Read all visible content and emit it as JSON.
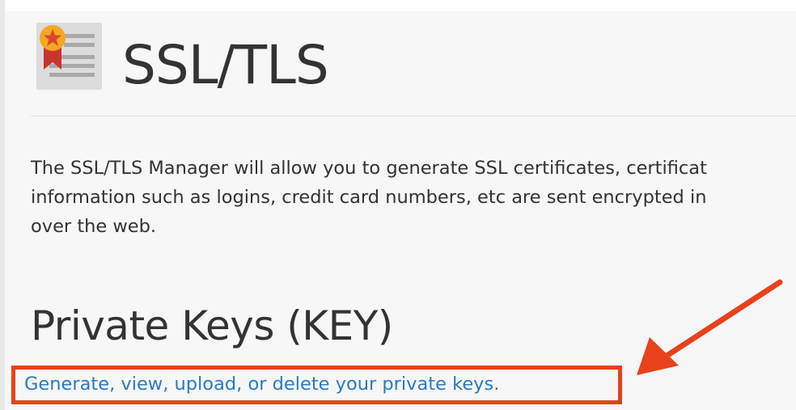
{
  "header": {
    "title": "SSL/TLS",
    "icon": "certificate-icon"
  },
  "description": {
    "text": "The SSL/TLS Manager will allow you to generate SSL certificates, certificat\ninformation such as logins, credit card numbers, etc are sent encrypted in\nover the web."
  },
  "private_keys": {
    "heading": "Private Keys (KEY)",
    "link_label": "Generate, view, upload, or delete your private keys."
  },
  "annotation": {
    "color": "#e8411c",
    "icon": "arrow-icon"
  },
  "colors": {
    "link": "#2a7bbf",
    "text": "#333333",
    "background": "#f7f7f7"
  }
}
